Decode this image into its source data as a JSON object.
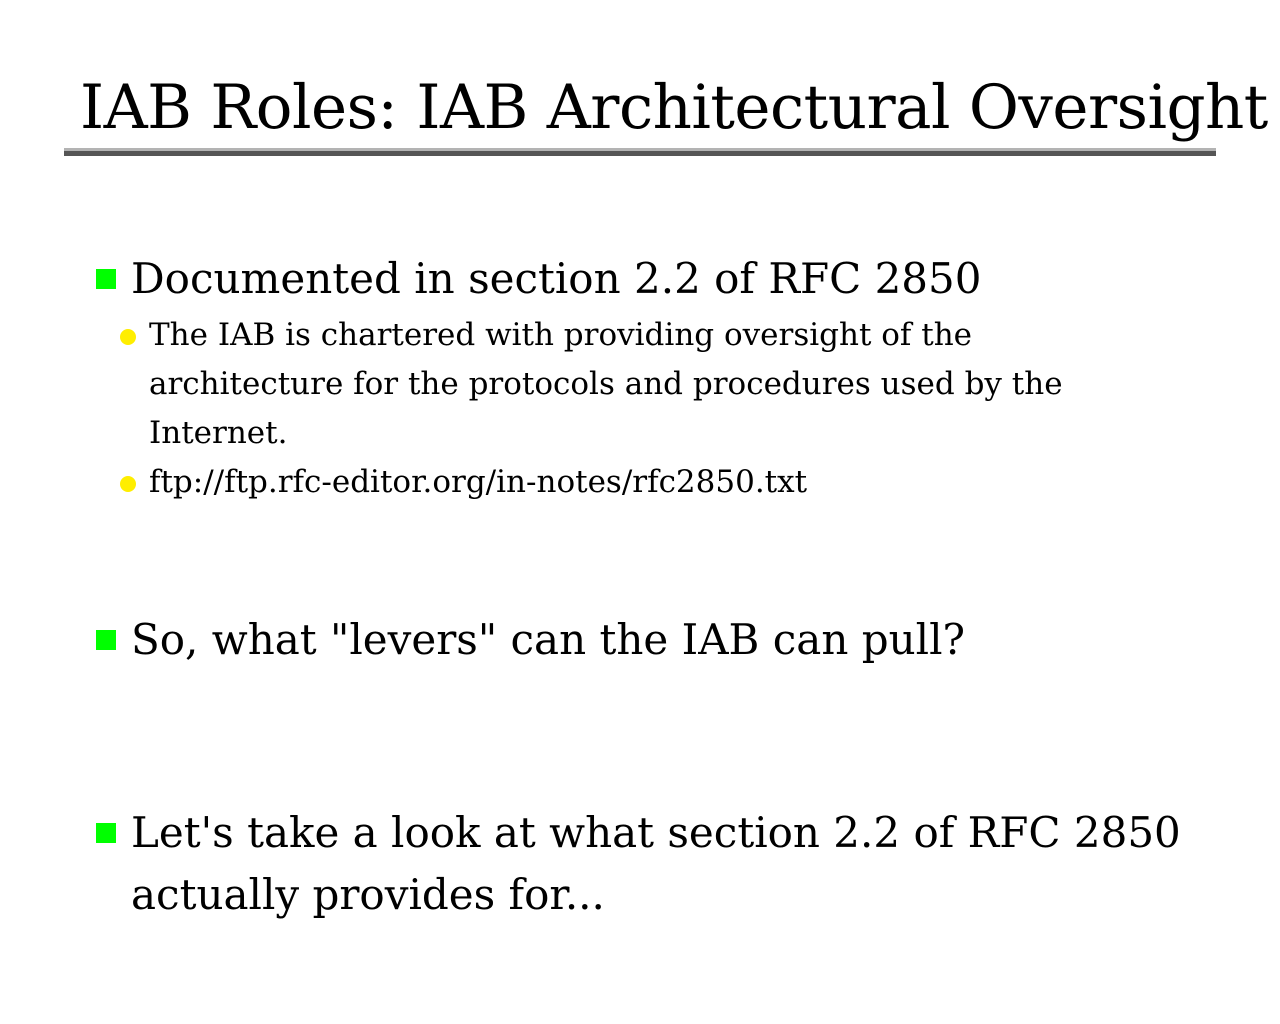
{
  "slide": {
    "title": "IAB Roles: IAB Architectural Oversight",
    "colors": {
      "bullet_primary": "#00ff00",
      "bullet_secondary": "#ffee00",
      "rule_dark": "#555555",
      "rule_light": "#b3b3b3"
    },
    "bullets": [
      {
        "text": "Documented in section 2.2 of RFC 2850",
        "subbullets": [
          {
            "lines": [
              "The IAB is chartered with providing oversight of the",
              "architecture for the protocols and procedures used by the",
              "Internet."
            ]
          },
          {
            "lines": [
              "ftp://ftp.rfc-editor.org/in-notes/rfc2850.txt"
            ]
          }
        ]
      },
      {
        "text": "So, what \"levers\" can the IAB can pull?"
      },
      {
        "lines": [
          "Let's take a look at what section 2.2 of RFC 2850",
          "actually provides for..."
        ]
      }
    ]
  }
}
